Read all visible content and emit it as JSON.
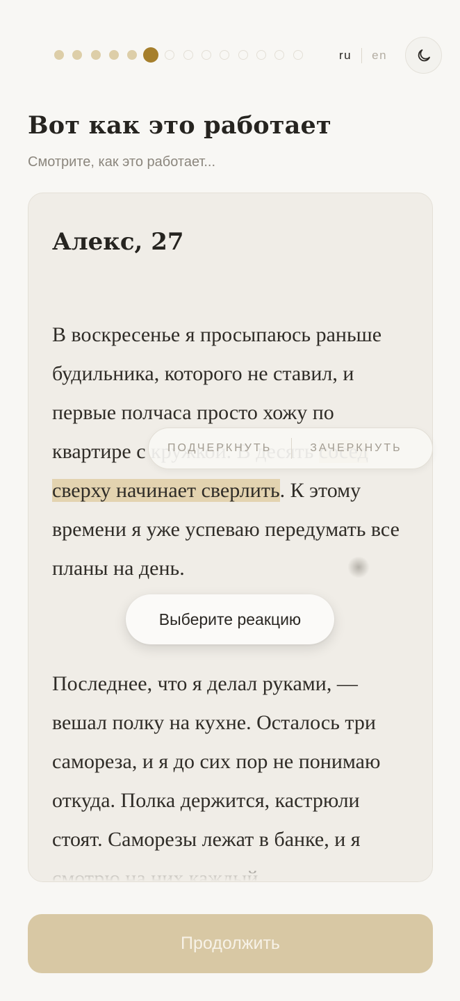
{
  "progress": {
    "completed": 5,
    "current": 6,
    "total": 14
  },
  "language": {
    "active": "ru",
    "inactive": "en"
  },
  "theme_toggle": {
    "icon": "moon-icon"
  },
  "header": {
    "title": "Вот как это работает",
    "subtitle": "Смотрите, как это работает..."
  },
  "story": {
    "author": "Алекс, 27",
    "p1": {
      "before": "В воскресенье я просыпаюсь раньше будильника, которого не ставил, и первые полчаса просто хожу по квартире с кружкой. В десять ",
      "highlight": "сосед сверху начинает сверлить",
      "after": ". К этому времени я уже успеваю передумать все планы на день."
    },
    "p2": "Последнее, что я делал руками, — вешал полку на кухне. Осталось три самореза, и я до сих пор не понимаю откуда. Полка держится, кастрюли стоят. Саморезы лежат в банке, и я смотрю на них каждый"
  },
  "selection_toolbar": {
    "underline": "ПОДЧЕРКНУТЬ",
    "strikethrough": "ЗАЧЕРКНУТЬ"
  },
  "reaction_prompt": "Выберите реакцию",
  "continue_button": "Продолжить",
  "colors": {
    "background": "#f8f7f4",
    "card": "#f0ede7",
    "accent": "#a67f2c",
    "dot_done": "#ddcea8",
    "highlight": "#e3d3b0",
    "button": "#d8c8a4"
  }
}
